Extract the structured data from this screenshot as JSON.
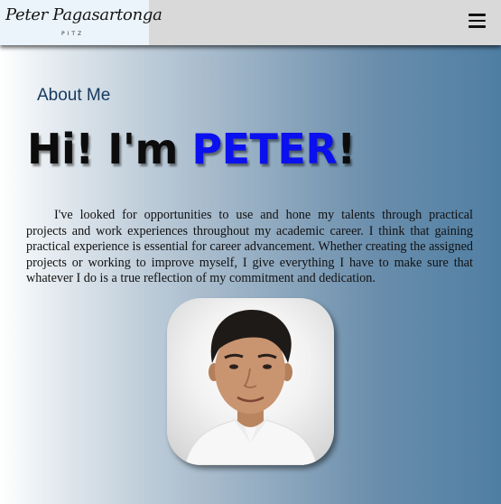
{
  "header": {
    "logo_text": "Peter Pagasartonga",
    "logo_subtext": "PITZ",
    "menu_icon": "hamburger-menu-icon"
  },
  "main": {
    "section_label": "About Me",
    "greeting_prefix": "Hi! I'm ",
    "name": "PETER",
    "greeting_suffix": "!",
    "bio": "I've looked for opportunities to use and hone my talents through practical projects and work experiences throughout my academic career. I think that gaining practical experience is essential for career advancement. Whether creating the assigned projects or working to improve myself, I give everything I have to make sure that whatever I do is a true reflection of my commitment and dedication."
  },
  "colors": {
    "name_accent": "#0b10ee",
    "section_label": "#173a60",
    "topbar": "#d9d9d9"
  }
}
